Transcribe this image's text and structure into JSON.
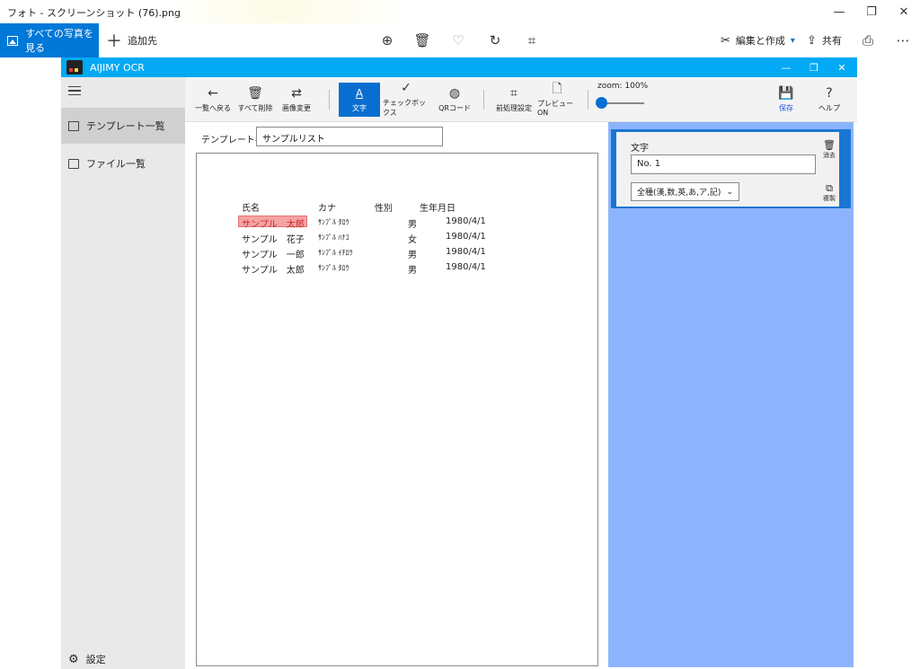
{
  "photos_window": {
    "title": "フォト - スクリーンショット (76).png",
    "controls": {
      "minimize": "—",
      "restore": "❐",
      "close": "✕"
    }
  },
  "photos_toolbar": {
    "all_photos": "すべての写真を見る",
    "add_to": "追加先",
    "edit_create": "編集と作成",
    "share": "共有",
    "icons": [
      "zoom-in-icon",
      "delete-icon",
      "favorite-icon",
      "rotate-icon",
      "crop-icon",
      "print-icon",
      "more-icon"
    ]
  },
  "ocr_window": {
    "title": "AIJIMY OCR",
    "controls": {
      "minimize": "—",
      "restore": "❐",
      "close": "✕"
    }
  },
  "sidebar": {
    "items": [
      {
        "label": "テンプレート一覧",
        "active": true
      },
      {
        "label": "ファイル一覧",
        "active": false
      }
    ],
    "settings": "設定"
  },
  "toolbar": {
    "back": "一覧へ戻る",
    "delete_all": "すべて削除",
    "change_image": "画像変更",
    "text": "文字",
    "checkbox": "チェックボックス",
    "qrcode": "QRコード",
    "preprocess": "前処理設定",
    "preview": "プレビューON",
    "zoom": "zoom: 100%",
    "save": "保存",
    "help": "ヘルプ"
  },
  "template": {
    "label": "テンプレート名：",
    "name": "サンプルリスト"
  },
  "document": {
    "headers": [
      "氏名",
      "カナ",
      "性別",
      "生年月日"
    ],
    "rows": [
      [
        "サンプル　太郎",
        "ｻﾝﾌﾟﾙ ﾀﾛｳ",
        "男",
        "1980/4/1"
      ],
      [
        "サンプル　花子",
        "ｻﾝﾌﾟﾙ ﾊﾅｺ",
        "女",
        "1980/4/1"
      ],
      [
        "サンプル　一郎",
        "ｻﾝﾌﾟﾙ ｲﾁﾛｳ",
        "男",
        "1980/4/1"
      ],
      [
        "サンプル　太郎",
        "ｻﾝﾌﾟﾙ ﾀﾛｳ",
        "男",
        "1980/4/1"
      ]
    ]
  },
  "field_panel": {
    "type_label": "文字",
    "value": "No. 1",
    "charset": "全種(漢,数,英,あ,ア,記)",
    "delete": "消去",
    "duplicate": "複製"
  },
  "colors": {
    "photos_accent": "#0078d7",
    "ocr_titlebar": "#03a9f4",
    "selected_tool": "#0a6ed1",
    "panel_bg": "#8cb4fd",
    "highlight": "#f4a3a3"
  }
}
